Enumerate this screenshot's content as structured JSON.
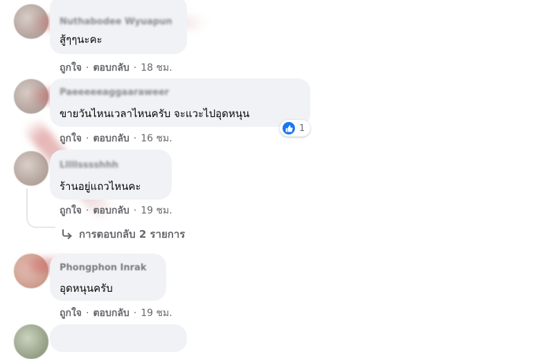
{
  "comments": [
    {
      "name": "Nuthabodee Wyuapun",
      "text": "สู้ๆๆนะคะ",
      "like_label": "ถูกใจ",
      "reply_label": "ตอบกลับ",
      "time": "18 ชม."
    },
    {
      "name": "Paeeeeeaggaaraweer",
      "text": "ขายวันไหนเวลาไหนครับ จะแวะไปอุดหนุน",
      "like_label": "ถูกใจ",
      "reply_label": "ตอบกลับ",
      "time": "16 ชม.",
      "reaction_count": "1"
    },
    {
      "name": "Lllllsssshhh",
      "text": "ร้านอยู่แถวไหนคะ",
      "like_label": "ถูกใจ",
      "reply_label": "ตอบกลับ",
      "time": "19 ชม.",
      "replies_label": "การตอบกลับ 2 รายการ"
    },
    {
      "name": "Phongphon Inrak",
      "text": "อุดหนุนครับ",
      "like_label": "ถูกใจ",
      "reply_label": "ตอบกลับ",
      "time": "19 ชม."
    }
  ],
  "colors": {
    "bubble": "#f0f2f5",
    "secondary_text": "#65676b",
    "like_blue": "#1877f2"
  },
  "icons": [
    "like-icon",
    "reply-arrow-icon"
  ]
}
